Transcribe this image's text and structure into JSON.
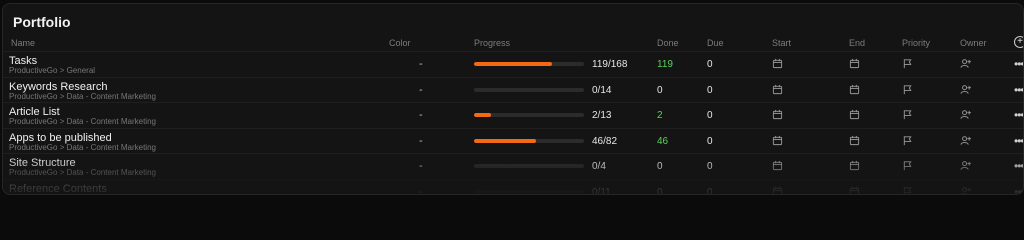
{
  "panel": {
    "title": "Portfolio"
  },
  "columns": {
    "name": "Name",
    "color": "Color",
    "progress": "Progress",
    "done": "Done",
    "due": "Due",
    "start": "Start",
    "end": "End",
    "priority": "Priority",
    "owner": "Owner",
    "add_icon": "plus-circle-icon"
  },
  "rows": [
    {
      "name": "Tasks",
      "path": "ProductiveGo > General",
      "color": "-",
      "progress_fraction": 0.71,
      "progress_text": "119/168",
      "done": "119",
      "done_green": true,
      "due": "0"
    },
    {
      "name": "Keywords Research",
      "path": "ProductiveGo > Data - Content Marketing",
      "color": "-",
      "progress_fraction": 0,
      "progress_text": "0/14",
      "done": "0",
      "done_green": false,
      "due": "0"
    },
    {
      "name": "Article List",
      "path": "ProductiveGo > Data - Content Marketing",
      "color": "-",
      "progress_fraction": 0.15,
      "progress_text": "2/13",
      "done": "2",
      "done_green": true,
      "due": "0"
    },
    {
      "name": "Apps to be published",
      "path": "ProductiveGo > Data - Content Marketing",
      "color": "-",
      "progress_fraction": 0.56,
      "progress_text": "46/82",
      "done": "46",
      "done_green": true,
      "due": "0"
    },
    {
      "name": "Site Structure",
      "path": "ProductiveGo > Data - Content Marketing",
      "color": "-",
      "progress_fraction": 0,
      "progress_text": "0/4",
      "done": "0",
      "done_green": false,
      "due": "0"
    },
    {
      "name": "Reference Contents",
      "path": "ProductiveGo > Data - Content Marketing",
      "color": "-",
      "progress_fraction": 0,
      "progress_text": "0/11",
      "done": "0",
      "done_green": false,
      "due": "0"
    }
  ],
  "colors": {
    "progress_fill": "#f46a14",
    "done_green": "#5bd05b"
  },
  "icons": {
    "start": "calendar-icon",
    "end": "calendar-icon",
    "priority": "flag-icon",
    "owner": "add-user-icon",
    "more": "more-dots-icon"
  }
}
